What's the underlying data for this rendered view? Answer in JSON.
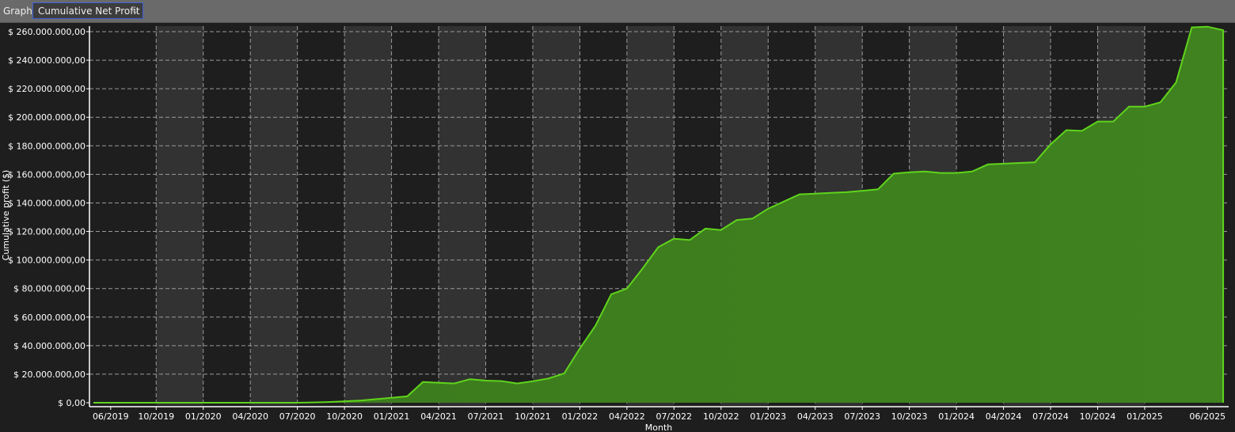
{
  "toolbar": {
    "label": "Graph",
    "selected": "Cumulative Net Profit",
    "chevron_icon": "chevron-down-icon"
  },
  "chart_data": {
    "type": "area",
    "title": "Cumulative Net Profit",
    "xlabel": "Month",
    "ylabel": "Cumulative profit ($)",
    "units": "millions USD",
    "ylim": [
      0,
      260
    ],
    "xlim": [
      0,
      72.3
    ],
    "grid": true,
    "colors": {
      "line": "#5fd41c",
      "fill": "#3f7f1f",
      "bg": "#1e1e1e",
      "band": "#323232"
    },
    "y_ticks": [
      {
        "v": 0,
        "label": "$ 0,00"
      },
      {
        "v": 20,
        "label": "$ 20.000.000,00"
      },
      {
        "v": 40,
        "label": "$ 40.000.000,00"
      },
      {
        "v": 60,
        "label": "$ 60.000.000,00"
      },
      {
        "v": 80,
        "label": "$ 80.000.000,00"
      },
      {
        "v": 100,
        "label": "$ 100.000.000,00"
      },
      {
        "v": 120,
        "label": "$ 120.000.000,00"
      },
      {
        "v": 140,
        "label": "$ 140.000.000,00"
      },
      {
        "v": 160,
        "label": "$ 160.000.000,00"
      },
      {
        "v": 180,
        "label": "$ 180.000.000,00"
      },
      {
        "v": 200,
        "label": "$ 200.000.000,00"
      },
      {
        "v": 220,
        "label": "$ 220.000.000,00"
      },
      {
        "v": 240,
        "label": "$ 240.000.000,00"
      },
      {
        "v": 260,
        "label": "$ 260.000.000,00"
      }
    ],
    "x_ticks": [
      {
        "at": 1.1,
        "label": "06/2019"
      },
      {
        "at": 4,
        "label": "10/2019"
      },
      {
        "at": 7,
        "label": "01/2020"
      },
      {
        "at": 10,
        "label": "04/2020"
      },
      {
        "at": 13,
        "label": "07/2020"
      },
      {
        "at": 16,
        "label": "10/2020"
      },
      {
        "at": 19,
        "label": "01/2021"
      },
      {
        "at": 22,
        "label": "04/2021"
      },
      {
        "at": 25,
        "label": "07/2021"
      },
      {
        "at": 28,
        "label": "10/2021"
      },
      {
        "at": 31,
        "label": "01/2022"
      },
      {
        "at": 34,
        "label": "04/2022"
      },
      {
        "at": 37,
        "label": "07/2022"
      },
      {
        "at": 40,
        "label": "10/2022"
      },
      {
        "at": 43,
        "label": "01/2023"
      },
      {
        "at": 46,
        "label": "04/2023"
      },
      {
        "at": 49,
        "label": "07/2023"
      },
      {
        "at": 52,
        "label": "10/2023"
      },
      {
        "at": 55,
        "label": "01/2024"
      },
      {
        "at": 58,
        "label": "04/2024"
      },
      {
        "at": 61,
        "label": "07/2024"
      },
      {
        "at": 64,
        "label": "10/2024"
      },
      {
        "at": 67,
        "label": "01/2025"
      },
      {
        "at": 71,
        "label": "06/2025"
      }
    ],
    "gridlines_x": [
      4,
      7,
      10,
      13,
      16,
      19,
      22,
      25,
      28,
      31,
      34,
      37,
      40,
      43,
      46,
      49,
      52,
      55,
      58,
      61,
      64,
      67
    ],
    "values": [
      0,
      0,
      0,
      0,
      0,
      0,
      0,
      0,
      0,
      0,
      0,
      0,
      0,
      0,
      0.2,
      0.5,
      1,
      1.5,
      2.5,
      3.5,
      4.5,
      14.5,
      14,
      13.5,
      16.5,
      15.5,
      15.2,
      13.5,
      15,
      17,
      20.5,
      38,
      54,
      76,
      80,
      94,
      109,
      115,
      114,
      122,
      121,
      128,
      129,
      136,
      141,
      146,
      146.5,
      147,
      147.5,
      148.5,
      149.5,
      160.5,
      161.5,
      162,
      161,
      161,
      162,
      167,
      167.5,
      168,
      168.5,
      181,
      191,
      190.5,
      197,
      197,
      207.5,
      207.5,
      210.5,
      224.5,
      263,
      263.5,
      261
    ]
  }
}
